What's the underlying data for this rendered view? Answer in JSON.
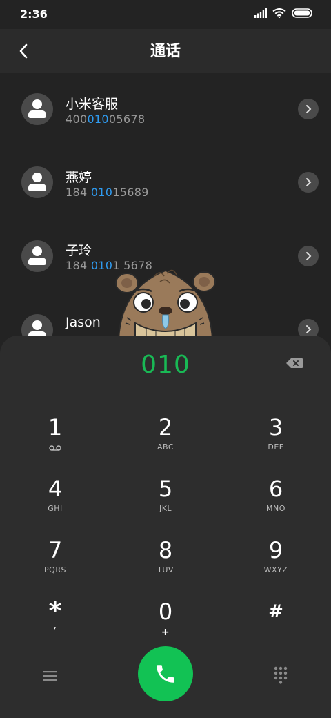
{
  "status_bar": {
    "time": "2:36"
  },
  "header": {
    "title": "通话"
  },
  "contacts": [
    {
      "name": "小米客服",
      "number_pre": "400",
      "number_hl": "010",
      "number_post": "05678"
    },
    {
      "name": "燕婷",
      "number_pre": "184 ",
      "number_hl": "010",
      "number_post": "15689"
    },
    {
      "name": "子玲",
      "number_pre": "184 ",
      "number_hl": "010",
      "number_post": "1 5678"
    },
    {
      "name": "Jason",
      "number_pre": "",
      "number_hl": "",
      "number_post": ""
    }
  ],
  "dialpad": {
    "input": "010",
    "keys": [
      {
        "digit": "1",
        "letters": ""
      },
      {
        "digit": "2",
        "letters": "ABC"
      },
      {
        "digit": "3",
        "letters": "DEF"
      },
      {
        "digit": "4",
        "letters": "GHI"
      },
      {
        "digit": "5",
        "letters": "JKL"
      },
      {
        "digit": "6",
        "letters": "MNO"
      },
      {
        "digit": "7",
        "letters": "PQRS"
      },
      {
        "digit": "8",
        "letters": "TUV"
      },
      {
        "digit": "9",
        "letters": "WXYZ"
      },
      {
        "digit": "*",
        "letters": ","
      },
      {
        "digit": "0",
        "letters": "+"
      },
      {
        "digit": "#",
        "letters": ""
      }
    ]
  },
  "colors": {
    "background": "#232323",
    "dialpad_bg": "#2d2d2d",
    "accent_green": "#12c254",
    "highlight_blue": "#2f9bf0"
  },
  "icons": [
    "signal-icon",
    "wifi-icon",
    "battery-icon",
    "back-arrow-icon",
    "chevron-right-icon",
    "voicemail-icon",
    "backspace-icon",
    "menu-icon",
    "phone-icon",
    "dialpad-icon"
  ]
}
